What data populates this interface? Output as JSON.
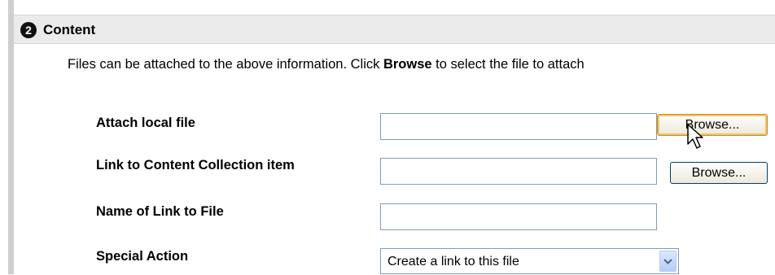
{
  "section": {
    "step": "2",
    "title": "Content"
  },
  "instructions": {
    "before": "Files can be attached to the above information. Click ",
    "bold": "Browse",
    "after": " to select the file to attach"
  },
  "fields": {
    "attach_local_file": {
      "label": "Attach local file",
      "value": "",
      "button_label": "Browse..."
    },
    "link_content_collection": {
      "label": "Link to Content Collection item",
      "value": "",
      "button_label": "Browse..."
    },
    "link_name": {
      "label": "Name of Link to File",
      "value": ""
    },
    "special_action": {
      "label": "Special Action",
      "selected": "Create a link to this file"
    }
  },
  "icons": {
    "step_badge": "numbered-circle-2-icon",
    "dropdown": "chevron-down-icon",
    "cursor": "mouse-pointer-icon"
  },
  "colors": {
    "header_bg": "#ebebeb",
    "left_rule": "#cfcfcf",
    "input_border": "#7f9db9"
  }
}
